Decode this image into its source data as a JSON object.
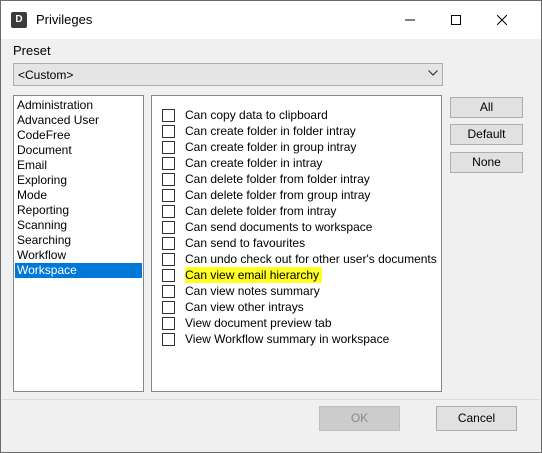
{
  "window": {
    "title": "Privileges",
    "app_icon_letter": "D"
  },
  "preset": {
    "label": "Preset",
    "selected": "<Custom>"
  },
  "categories": [
    "Administration",
    "Advanced User",
    "CodeFree",
    "Document",
    "Email",
    "Exploring",
    "Mode",
    "Reporting",
    "Scanning",
    "Searching",
    "Workflow",
    "Workspace"
  ],
  "selected_category": "Workspace",
  "privileges": [
    {
      "label": "Can copy data to clipboard",
      "checked": false,
      "highlighted": false
    },
    {
      "label": "Can create folder in folder intray",
      "checked": false,
      "highlighted": false
    },
    {
      "label": "Can create folder in group intray",
      "checked": false,
      "highlighted": false
    },
    {
      "label": "Can create folder in intray",
      "checked": false,
      "highlighted": false
    },
    {
      "label": "Can delete folder from folder intray",
      "checked": false,
      "highlighted": false
    },
    {
      "label": "Can delete folder from group intray",
      "checked": false,
      "highlighted": false
    },
    {
      "label": "Can delete folder from intray",
      "checked": false,
      "highlighted": false
    },
    {
      "label": "Can send documents to workspace",
      "checked": false,
      "highlighted": false
    },
    {
      "label": "Can send to favourites",
      "checked": false,
      "highlighted": false
    },
    {
      "label": "Can undo check out for other user's documents",
      "checked": false,
      "highlighted": false
    },
    {
      "label": "Can view email hierarchy",
      "checked": false,
      "highlighted": true
    },
    {
      "label": "Can view notes summary",
      "checked": false,
      "highlighted": false
    },
    {
      "label": "Can view other intrays",
      "checked": false,
      "highlighted": false
    },
    {
      "label": "View document preview tab",
      "checked": false,
      "highlighted": false
    },
    {
      "label": "View Workflow summary in workspace",
      "checked": false,
      "highlighted": false
    }
  ],
  "buttons": {
    "all": "All",
    "default": "Default",
    "none": "None",
    "ok": "OK",
    "cancel": "Cancel"
  },
  "colors": {
    "selection": "#0078d7",
    "highlight": "#ffff22"
  },
  "icons": {
    "minimize": "minimize-icon",
    "maximize": "maximize-icon",
    "close": "close-icon",
    "dropdown": "chevron-down-icon"
  }
}
